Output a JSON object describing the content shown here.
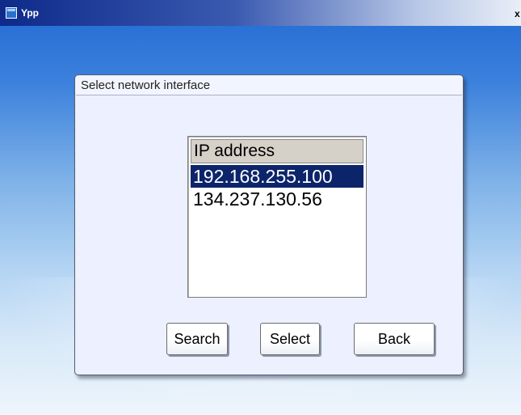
{
  "window": {
    "title": "Ypp",
    "close_glyph": "x"
  },
  "dialog": {
    "title": "Select network interface",
    "list": {
      "header": "IP address",
      "items": [
        {
          "label": "192.168.255.100",
          "selected": true
        },
        {
          "label": "134.237.130.56",
          "selected": false
        }
      ]
    },
    "buttons": {
      "search": "Search",
      "select": "Select",
      "back": "Back"
    }
  },
  "colors": {
    "selection_bg": "#0c246a",
    "dialog_bg": "#ecf0ff",
    "titlebar_start": "#0e2a8a"
  },
  "icons": {
    "app": "app-window-icon"
  }
}
